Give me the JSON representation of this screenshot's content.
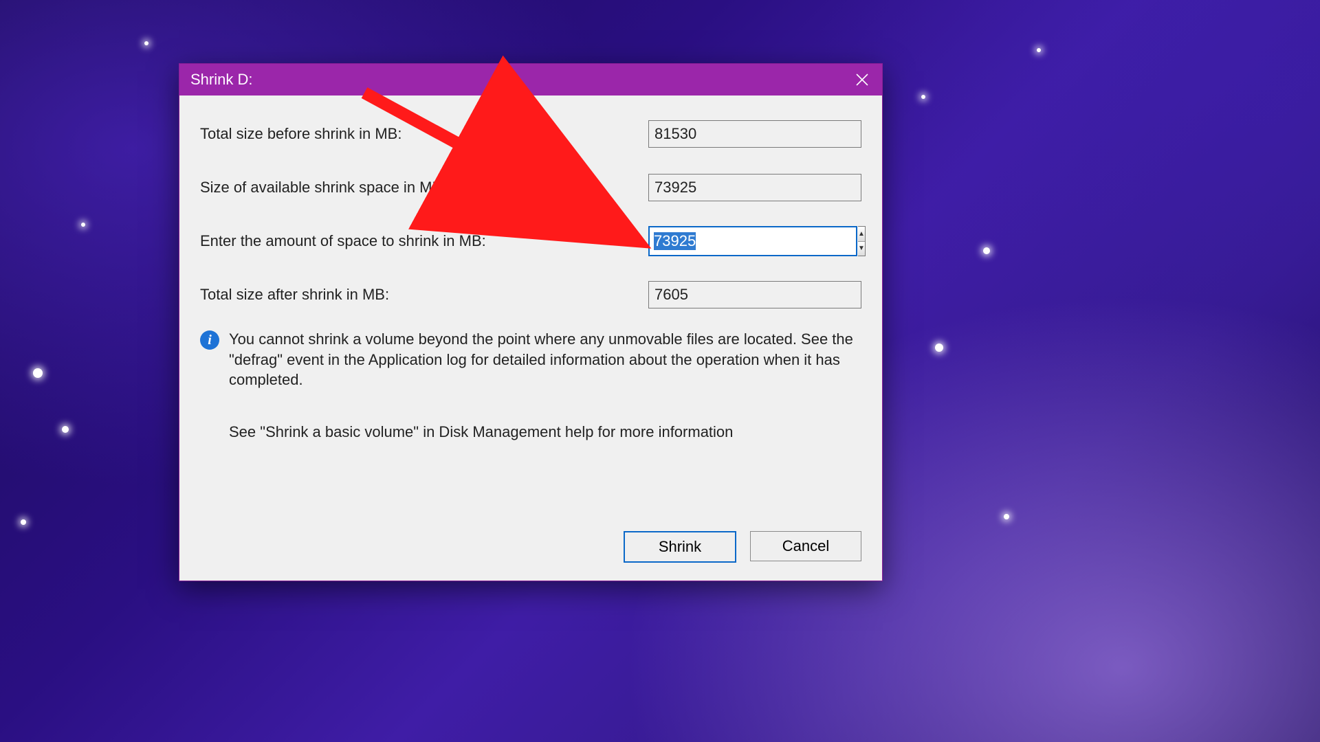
{
  "titlebar": {
    "title": "Shrink D:"
  },
  "fields": {
    "total_before": {
      "label": "Total size before shrink in MB:",
      "value": "81530"
    },
    "available": {
      "label": "Size of available shrink space in MB:",
      "value": "73925"
    },
    "to_shrink": {
      "label": "Enter the amount of space to shrink in MB:",
      "value": "73925"
    },
    "total_after": {
      "label": "Total size after shrink in MB:",
      "value": "7605"
    }
  },
  "info_text": "You cannot shrink a volume beyond the point where any unmovable files are located. See the \"defrag\" event in the Application log for detailed information about the operation when it has completed.",
  "help_text": "See \"Shrink a basic volume\" in Disk Management help for more information",
  "buttons": {
    "shrink": "Shrink",
    "cancel": "Cancel"
  },
  "colors": {
    "titlebar": "#9b26aa",
    "focus_border": "#0a68c8",
    "arrow": "#ff1a1a"
  }
}
